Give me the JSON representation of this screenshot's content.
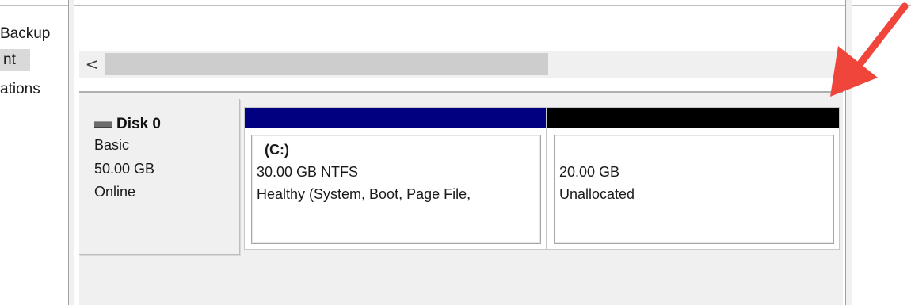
{
  "nav": {
    "items": [
      {
        "label": "Backup"
      },
      {
        "label": "nt"
      },
      {
        "label": "ations"
      }
    ]
  },
  "scrollbar": {
    "left_arrow": "<"
  },
  "disk": {
    "name": "Disk 0",
    "type": "Basic",
    "size": "50.00 GB",
    "status": "Online"
  },
  "partitions": [
    {
      "label": "(C:)",
      "size_fs": "30.00 GB NTFS",
      "status": "Healthy (System, Boot, Page File,",
      "bar_color": "#000080"
    },
    {
      "size": "20.00 GB",
      "status": "Unallocated",
      "bar_color": "#000000"
    }
  ],
  "annotation": {
    "arrow_color": "#f0453a"
  }
}
